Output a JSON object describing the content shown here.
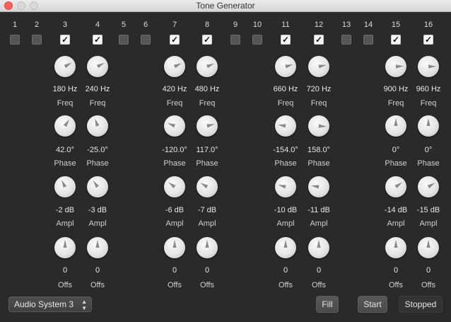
{
  "window": {
    "title": "Tone Generator"
  },
  "channels": [
    {
      "number": "1",
      "enabled": false
    },
    {
      "number": "2",
      "enabled": false
    },
    {
      "number": "3",
      "enabled": true,
      "freq": "180 Hz",
      "phase": "42.0°",
      "ampl": "-2 dB",
      "offs": "0",
      "knob_levels": {
        "freq": 0.72,
        "phase": 0.62,
        "ampl": 0.4,
        "offs": 0.5
      }
    },
    {
      "number": "4",
      "enabled": true,
      "freq": "240 Hz",
      "phase": "-25.0°",
      "ampl": "-3 dB",
      "offs": "0",
      "knob_levels": {
        "freq": 0.73,
        "phase": 0.43,
        "ampl": 0.37,
        "offs": 0.5
      }
    },
    {
      "number": "5",
      "enabled": false
    },
    {
      "number": "6",
      "enabled": false
    },
    {
      "number": "7",
      "enabled": true,
      "freq": "420 Hz",
      "phase": "-120.0°",
      "ampl": "-6 dB",
      "offs": "0",
      "knob_levels": {
        "freq": 0.74,
        "phase": 0.25,
        "ampl": 0.3,
        "offs": 0.5
      }
    },
    {
      "number": "8",
      "enabled": true,
      "freq": "480 Hz",
      "phase": "117.0°",
      "ampl": "-7 dB",
      "offs": "0",
      "knob_levels": {
        "freq": 0.75,
        "phase": 0.78,
        "ampl": 0.28,
        "offs": 0.5
      }
    },
    {
      "number": "9",
      "enabled": false
    },
    {
      "number": "10",
      "enabled": false
    },
    {
      "number": "11",
      "enabled": true,
      "freq": "660 Hz",
      "phase": "-154.0°",
      "ampl": "-10 dB",
      "offs": "0",
      "knob_levels": {
        "freq": 0.78,
        "phase": 0.2,
        "ampl": 0.22,
        "offs": 0.5
      }
    },
    {
      "number": "12",
      "enabled": true,
      "freq": "720 Hz",
      "phase": "158.0°",
      "ampl": "-11 dB",
      "offs": "0",
      "knob_levels": {
        "freq": 0.79,
        "phase": 0.85,
        "ampl": 0.2,
        "offs": 0.5
      }
    },
    {
      "number": "13",
      "enabled": false
    },
    {
      "number": "14",
      "enabled": false
    },
    {
      "number": "15",
      "enabled": true,
      "freq": "900 Hz",
      "phase": "0°",
      "ampl": "-14 dB",
      "offs": "0",
      "knob_levels": {
        "freq": 0.82,
        "phase": 0.5,
        "ampl": 0.7,
        "offs": 0.5
      }
    },
    {
      "number": "16",
      "enabled": true,
      "freq": "960 Hz",
      "phase": "0°",
      "ampl": "-15 dB",
      "offs": "0",
      "knob_levels": {
        "freq": 0.83,
        "phase": 0.5,
        "ampl": 0.72,
        "offs": 0.5
      }
    }
  ],
  "labels": {
    "freq": "Freq",
    "phase": "Phase",
    "ampl": "Ampl",
    "offs": "Offs"
  },
  "footer": {
    "device_select": "Audio System 3",
    "fill_button": "Fill",
    "start_button": "Start",
    "status": "Stopped"
  },
  "icons": {
    "checkmark": "✓",
    "popup_arrows": "▲▼"
  },
  "colors": {
    "background": "#2a2a2a",
    "knob": "#e4e4e4",
    "close": "#fc605c"
  }
}
